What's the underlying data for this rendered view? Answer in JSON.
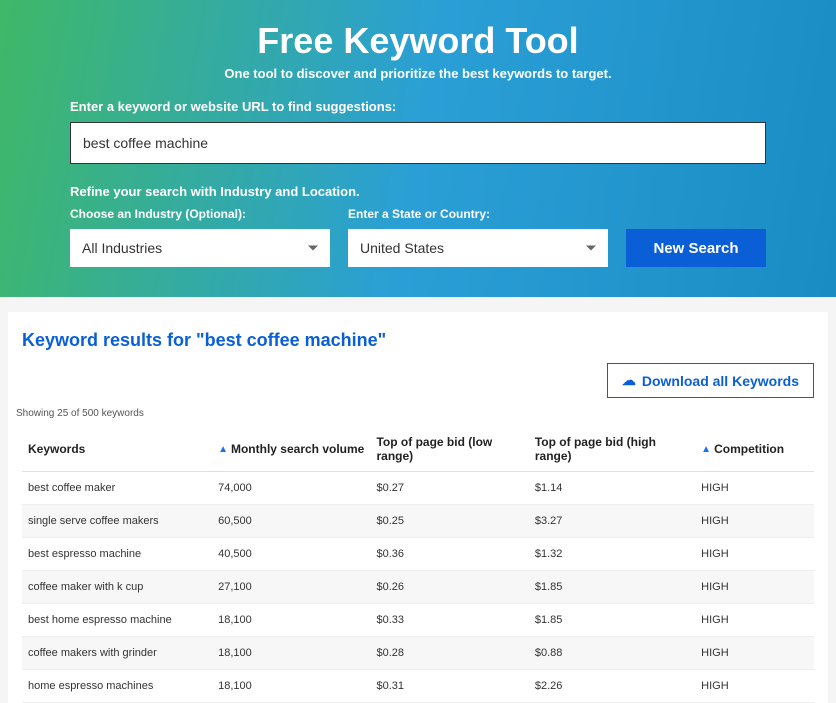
{
  "hero": {
    "title": "Free Keyword Tool",
    "subtitle": "One tool to discover and prioritize the best keywords to target.",
    "input_label": "Enter a keyword or website URL to find suggestions:",
    "input_value": "best coffee machine",
    "refine_label": "Refine your search with Industry and Location.",
    "industry_label": "Choose an Industry (Optional):",
    "industry_value": "All Industries",
    "location_label": "Enter a State or Country:",
    "location_value": "United States",
    "search_button": "New Search"
  },
  "results": {
    "title_prefix": "Keyword results for \"",
    "title_term": "best coffee machine",
    "title_suffix": "\"",
    "download_button": "Download all Keywords",
    "showing_text": "Showing 25 of 500 keywords",
    "headers": {
      "keywords": "Keywords",
      "volume": "Monthly search volume",
      "bid_low": "Top of page bid (low range)",
      "bid_high": "Top of page bid (high range)",
      "competition": "Competition"
    },
    "rows": [
      {
        "kw": "best coffee maker",
        "vol": "74,000",
        "low": "$0.27",
        "high": "$1.14",
        "comp": "HIGH"
      },
      {
        "kw": "single serve coffee makers",
        "vol": "60,500",
        "low": "$0.25",
        "high": "$3.27",
        "comp": "HIGH"
      },
      {
        "kw": "best espresso machine",
        "vol": "40,500",
        "low": "$0.36",
        "high": "$1.32",
        "comp": "HIGH"
      },
      {
        "kw": "coffee maker with k cup",
        "vol": "27,100",
        "low": "$0.26",
        "high": "$1.85",
        "comp": "HIGH"
      },
      {
        "kw": "best home espresso machine",
        "vol": "18,100",
        "low": "$0.33",
        "high": "$1.85",
        "comp": "HIGH"
      },
      {
        "kw": "coffee makers with grinder",
        "vol": "18,100",
        "low": "$0.28",
        "high": "$0.88",
        "comp": "HIGH"
      },
      {
        "kw": "home espresso machines",
        "vol": "18,100",
        "low": "$0.31",
        "high": "$2.26",
        "comp": "HIGH"
      }
    ]
  }
}
